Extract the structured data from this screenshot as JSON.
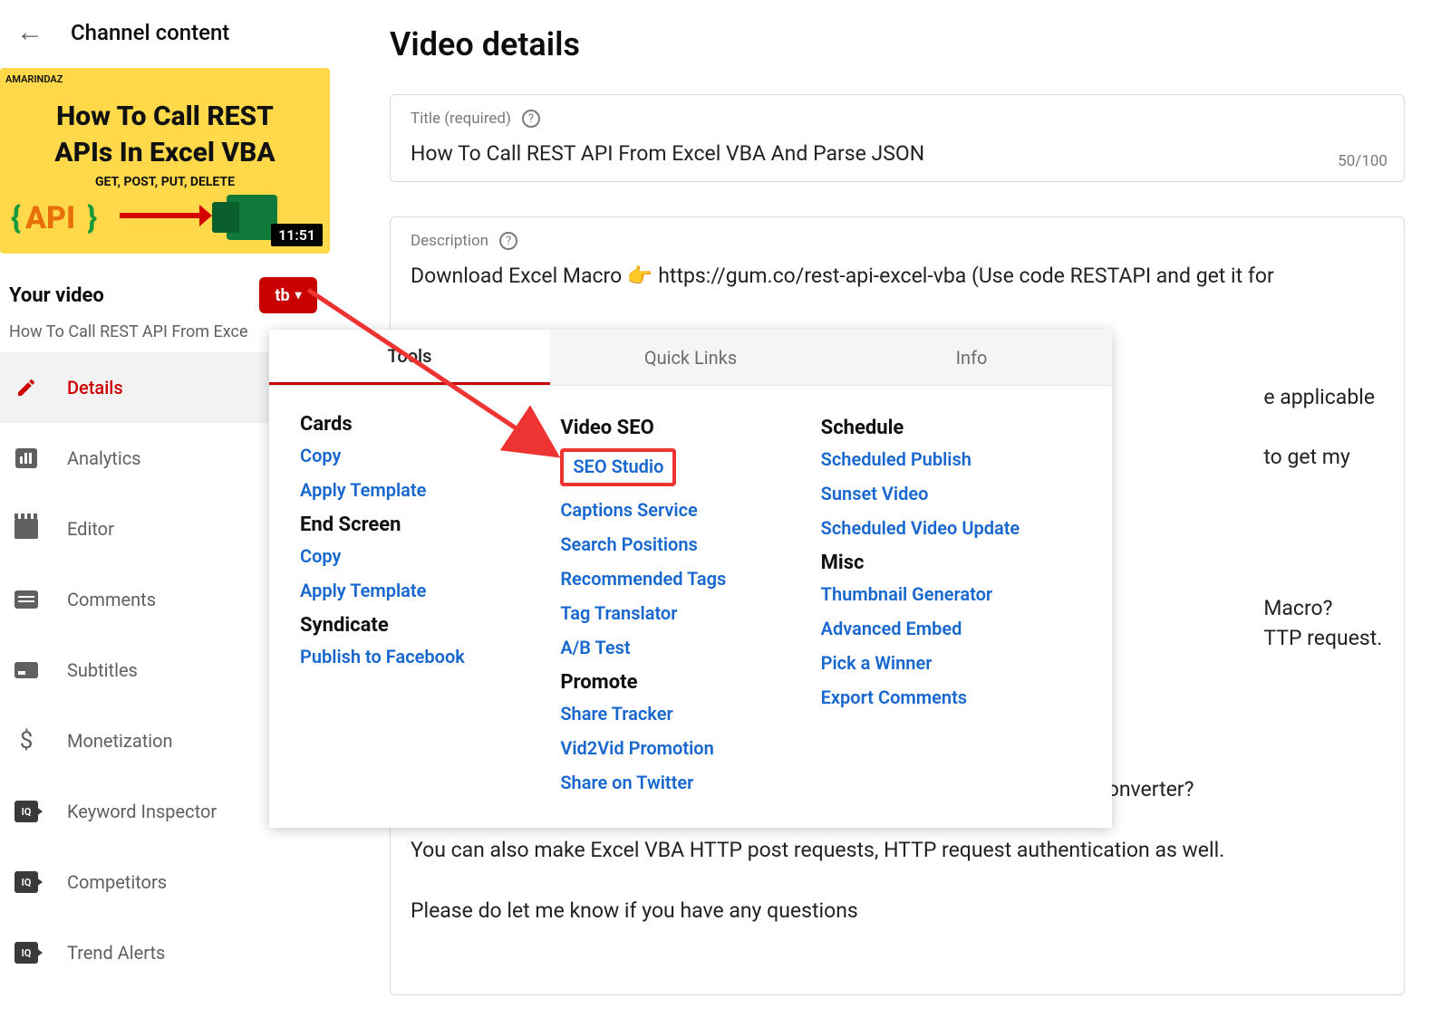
{
  "header": {
    "back_glyph": "←",
    "title": "Channel content"
  },
  "thumb": {
    "brand": "AMARINDAZ",
    "line1": "How To Call REST",
    "line2": "APIs In Excel VBA",
    "line3": "GET, POST, PUT, DELETE",
    "api": "API",
    "brace_l": "{",
    "brace_r": "}",
    "duration": "11:51"
  },
  "sidebar": {
    "your_video": "Your video",
    "tubebuddy_glyph": "tb",
    "subtitle": "How To Call REST API From Exce",
    "items": [
      {
        "label": "Details",
        "icon": "pencil",
        "active": true
      },
      {
        "label": "Analytics",
        "icon": "bars",
        "active": false
      },
      {
        "label": "Editor",
        "icon": "film",
        "active": false
      },
      {
        "label": "Comments",
        "icon": "comment",
        "active": false
      },
      {
        "label": "Subtitles",
        "icon": "sub",
        "active": false
      },
      {
        "label": "Monetization",
        "icon": "dollar",
        "active": false
      },
      {
        "label": "Keyword Inspector",
        "icon": "iq",
        "active": false
      },
      {
        "label": "Competitors",
        "icon": "iq",
        "active": false
      },
      {
        "label": "Trend Alerts",
        "icon": "iq",
        "active": false
      }
    ]
  },
  "page": {
    "title": "Video details"
  },
  "title_field": {
    "label": "Title (required)",
    "value": "How To Call REST API From Excel VBA And Parse JSON",
    "counter": "50/100"
  },
  "desc_field": {
    "label": "Description",
    "value": "Download Excel Macro 👉 https://gum.co/rest-api-excel-vba (Use code RESTAPI and get it for\n\n\n\n                                                                                                                                                                     e applicable only to the first\n                                                                                                                                                                     to get my future products\n\n\n\n                                                                                                                                                                     Macro?\n                                                                                                                                                                     TTP request.\n\n\n\n\n✔ How to parse or convert the REST API response with a third party JSON converter?\n\nYou can also make Excel VBA HTTP post requests, HTTP request authentication as well.\n\nPlease do let me know if you have any questions"
  },
  "popup": {
    "tabs": [
      "Tools",
      "Quick Links",
      "Info"
    ],
    "col1": {
      "g1": "Cards",
      "g1_links": [
        "Copy",
        "Apply Template"
      ],
      "g2": "End Screen",
      "g2_links": [
        "Copy",
        "Apply Template"
      ],
      "g3": "Syndicate",
      "g3_links": [
        "Publish to Facebook"
      ]
    },
    "col2": {
      "g1": "Video SEO",
      "g1_links": [
        "SEO Studio",
        "Captions Service",
        "Search Positions",
        "Recommended Tags",
        "Tag Translator",
        "A/B Test"
      ],
      "g2": "Promote",
      "g2_links": [
        "Share Tracker",
        "Vid2Vid Promotion",
        "Share on Twitter"
      ]
    },
    "col3": {
      "g1": "Schedule",
      "g1_links": [
        "Scheduled Publish",
        "Sunset Video",
        "Scheduled Video Update"
      ],
      "g2": "Misc",
      "g2_links": [
        "Thumbnail Generator",
        "Advanced Embed",
        "Pick a Winner",
        "Export Comments"
      ]
    }
  }
}
